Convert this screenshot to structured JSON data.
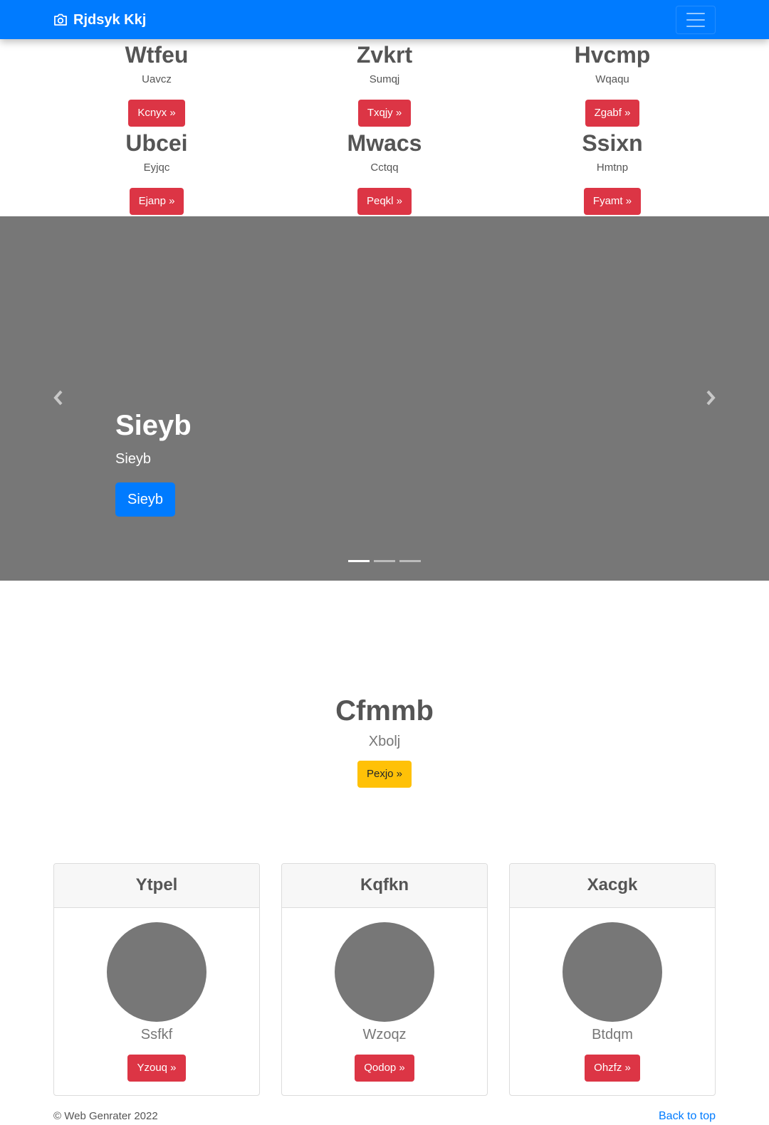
{
  "navbar": {
    "brand": "Rjdsyk Kkj",
    "icon": "camera-icon",
    "toggler_icon": "hamburger-icon"
  },
  "features": [
    {
      "title": "Wtfeu",
      "text": "Uavcz",
      "button": "Kcnyx »"
    },
    {
      "title": "Zvkrt",
      "text": "Sumqj",
      "button": "Txqjy »"
    },
    {
      "title": "Hvcmp",
      "text": "Wqaqu",
      "button": "Zgabf »"
    },
    {
      "title": "Ubcei",
      "text": "Eyjqc",
      "button": "Ejanp »"
    },
    {
      "title": "Mwacs",
      "text": "Cctqq",
      "button": "Peqkl »"
    },
    {
      "title": "Ssixn",
      "text": "Hmtnp",
      "button": "Fyamt »"
    }
  ],
  "carousel": {
    "title": "Sieyb",
    "text": "Sieyb",
    "button": "Sieyb",
    "slides": 3,
    "active_slide": 1
  },
  "hero": {
    "title": "Cfmmb",
    "text": "Xbolj",
    "button": "Pexjo »"
  },
  "cards": [
    {
      "header": "Ytpel",
      "text": "Ssfkf",
      "button": "Yzouq »"
    },
    {
      "header": "Kqfkn",
      "text": "Wzoqz",
      "button": "Qodop »"
    },
    {
      "header": "Xacgk",
      "text": "Btdqm",
      "button": "Ohzfz »"
    }
  ],
  "footer": {
    "copyright": "© Web Genrater 2022",
    "back_to_top": "Back to top"
  },
  "colors": {
    "primary": "#007bff",
    "danger": "#dc3545",
    "warning": "#ffc107",
    "placeholder": "#777777"
  }
}
